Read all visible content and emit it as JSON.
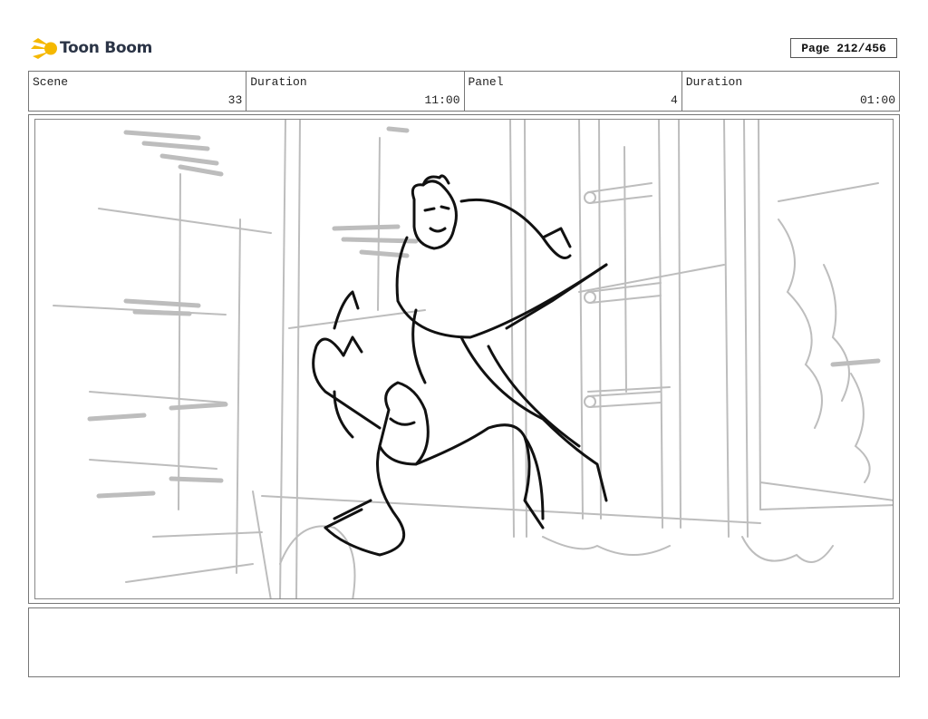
{
  "header": {
    "brand": "Toon Boom",
    "page_label": "Page 212/456"
  },
  "info": {
    "scene_label": "Scene",
    "scene_value": "33",
    "scene_duration_label": "Duration",
    "scene_duration_value": "11:00",
    "panel_label": "Panel",
    "panel_value": "4",
    "panel_duration_label": "Duration",
    "panel_duration_value": "01:00"
  },
  "notes": {
    "text": ""
  },
  "colors": {
    "brand_yellow": "#f5b800",
    "brand_text": "#2b3446",
    "sketch_gray": "#bdbdbd",
    "sketch_black": "#111111"
  }
}
